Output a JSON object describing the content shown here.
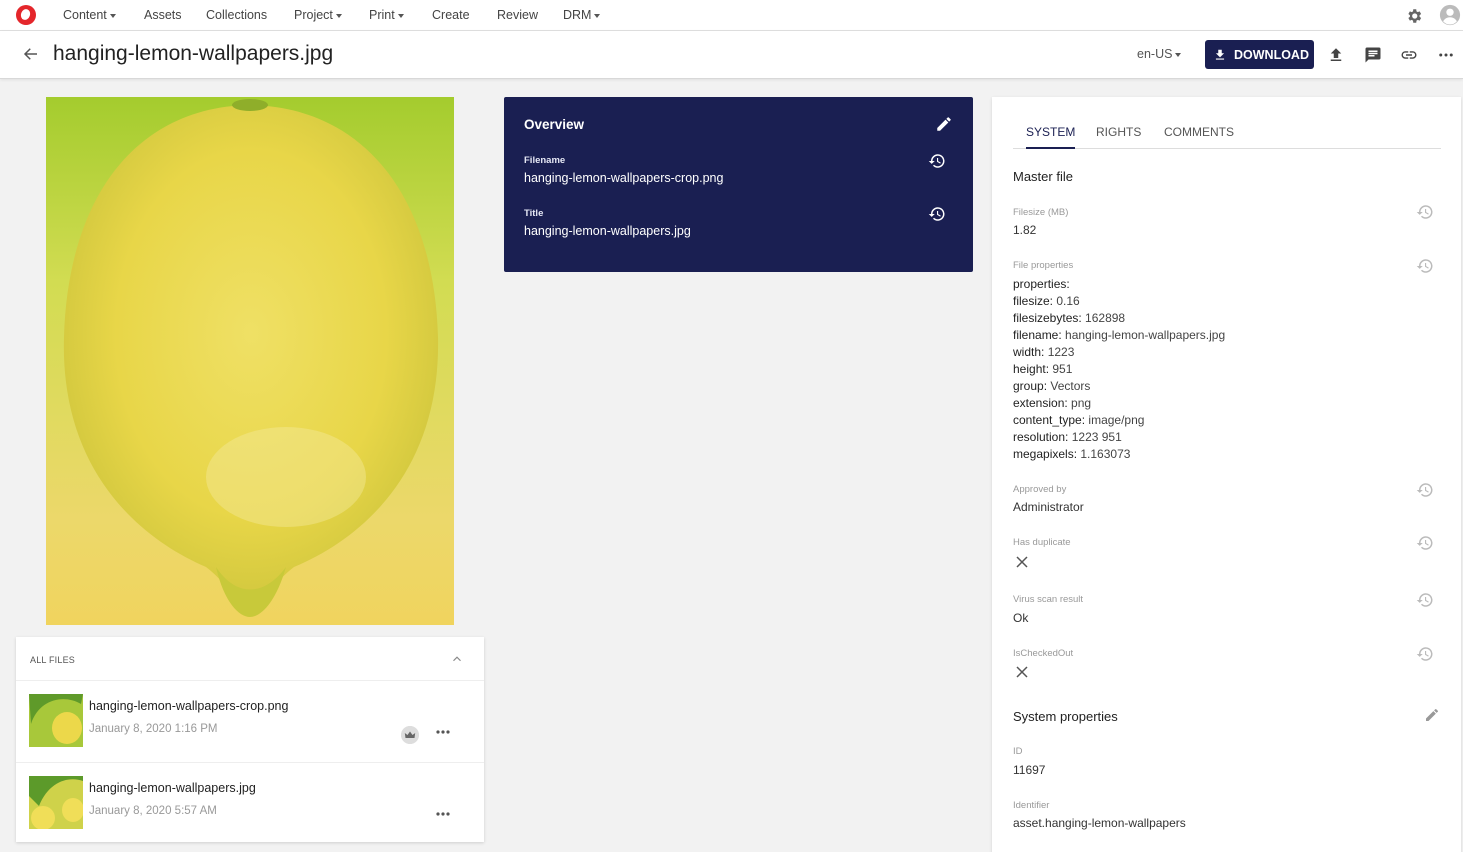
{
  "nav": {
    "items": [
      {
        "label": "Content",
        "dropdown": true
      },
      {
        "label": "Assets",
        "dropdown": false
      },
      {
        "label": "Collections",
        "dropdown": false
      },
      {
        "label": "Project",
        "dropdown": true
      },
      {
        "label": "Print",
        "dropdown": true
      },
      {
        "label": "Create",
        "dropdown": false
      },
      {
        "label": "Review",
        "dropdown": false
      },
      {
        "label": "DRM",
        "dropdown": true
      }
    ],
    "icons": [
      "logo",
      "gear-icon",
      "user-avatar-icon"
    ]
  },
  "header": {
    "title": "hanging-lemon-wallpapers.jpg",
    "locale": "en-US",
    "download_label": "DOWNLOAD",
    "accent": "#1a1f52"
  },
  "files": {
    "title": "ALL FILES",
    "items": [
      {
        "name": "hanging-lemon-wallpapers-crop.png",
        "date": "January 8, 2020 1:16 PM",
        "master": true
      },
      {
        "name": "hanging-lemon-wallpapers.jpg",
        "date": "January 8, 2020 5:57 AM",
        "master": false
      }
    ]
  },
  "overview": {
    "title": "Overview",
    "filename_label": "Filename",
    "filename_value": "hanging-lemon-wallpapers-crop.png",
    "title_label": "Title",
    "title_value": "hanging-lemon-wallpapers.jpg"
  },
  "panel": {
    "tabs": [
      "SYSTEM",
      "RIGHTS",
      "COMMENTS"
    ],
    "active_tab": "SYSTEM",
    "master_file": "Master file",
    "filesize_label": "Filesize (MB)",
    "filesize_value": "1.82",
    "file_props_label": "File properties",
    "file_props": [
      {
        "k": "properties:",
        "v": ""
      },
      {
        "k": "filesize:",
        "v": "0.16"
      },
      {
        "k": "filesizebytes:",
        "v": "162898"
      },
      {
        "k": "filename:",
        "v": "hanging-lemon-wallpapers.jpg"
      },
      {
        "k": "width:",
        "v": "1223"
      },
      {
        "k": "height:",
        "v": "951"
      },
      {
        "k": "group:",
        "v": "Vectors"
      },
      {
        "k": "extension:",
        "v": "png"
      },
      {
        "k": "content_type:",
        "v": "image/png"
      },
      {
        "k": "resolution:",
        "v": "1223 951"
      },
      {
        "k": "megapixels:",
        "v": "1.163073"
      }
    ],
    "approved_label": "Approved by",
    "approved_value": "Administrator",
    "duplicate_label": "Has duplicate",
    "virus_label": "Virus scan result",
    "virus_value": "Ok",
    "checkedout_label": "IsCheckedOut",
    "system_props": "System properties",
    "id_label": "ID",
    "id_value": "11697",
    "identifier_label": "Identifier",
    "identifier_value": "asset.hanging-lemon-wallpapers"
  }
}
